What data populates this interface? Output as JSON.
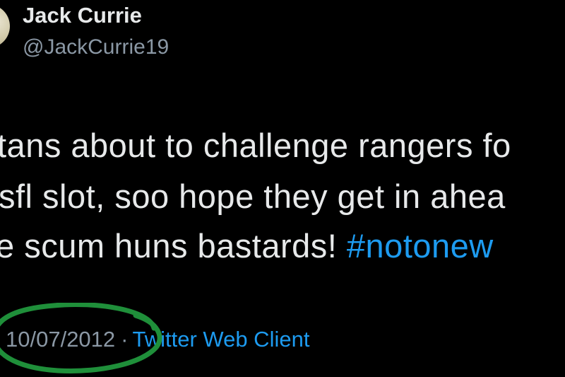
{
  "author": {
    "display_name": "Jack Currie",
    "handle": "@JackCurrie19",
    "avatar_icon": "avatar-photo"
  },
  "tweet": {
    "line1": "tans about to challenge rangers fo",
    "line2": "sfl slot, soo hope they get in ahea",
    "line3_text": "e scum huns bastards! ",
    "line3_hashtag": "#notonew"
  },
  "meta": {
    "date": "10/07/2012",
    "separator": "·",
    "client": "Twitter Web Client"
  },
  "colors": {
    "background": "#000000",
    "text": "#e7e9ea",
    "secondary": "#8b98a5",
    "link": "#1d9bf0",
    "annotation": "#1f8f3a"
  }
}
